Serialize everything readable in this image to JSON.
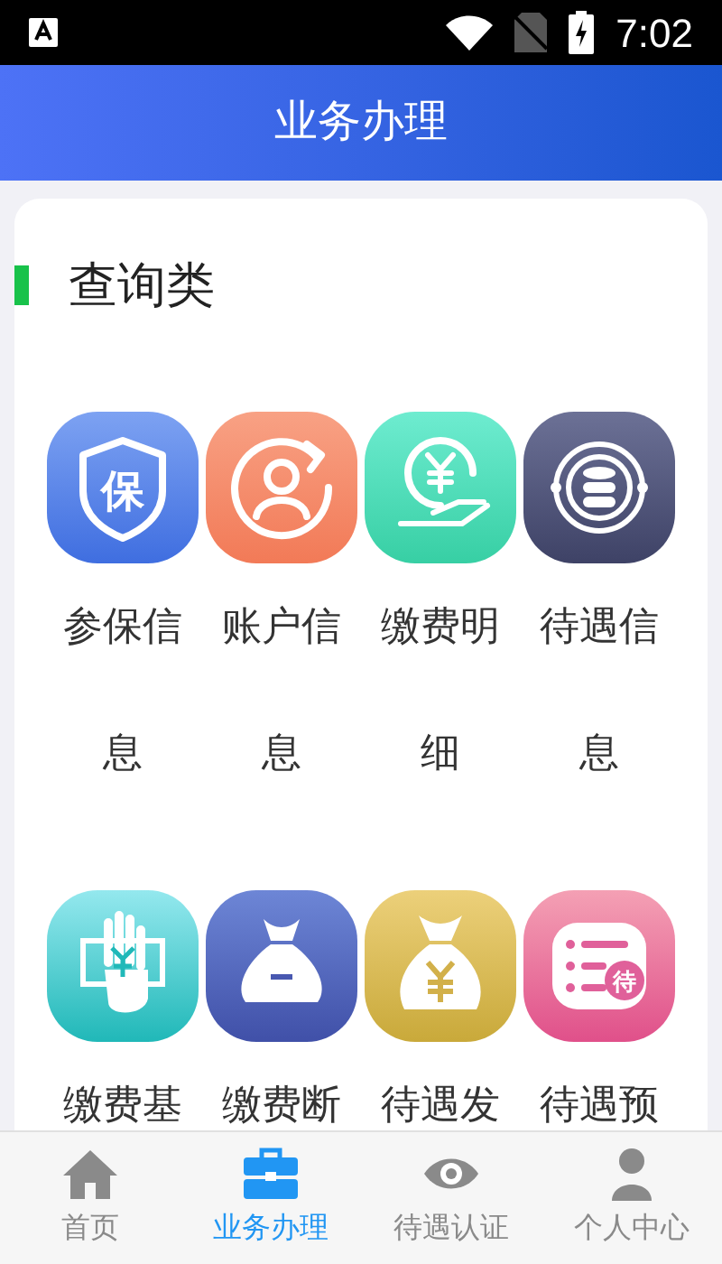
{
  "status_bar": {
    "time": "7:02"
  },
  "header": {
    "title": "业务办理"
  },
  "section": {
    "title": "查询类",
    "items": [
      {
        "kind": "shield",
        "label": "参保信息",
        "icon_text": "保"
      },
      {
        "kind": "account",
        "label": "账户信息"
      },
      {
        "kind": "payment",
        "label": "缴费明细"
      },
      {
        "kind": "database",
        "label": "待遇信息"
      },
      {
        "kind": "cash",
        "label": "缴费基"
      },
      {
        "kind": "bag-minus",
        "label": "缴费断"
      },
      {
        "kind": "bag-yen",
        "label": "待遇发"
      },
      {
        "kind": "list",
        "label": "待遇预",
        "icon_text": "待"
      }
    ]
  },
  "bottom_nav": [
    {
      "kind": "home",
      "label": "首页",
      "selected": false
    },
    {
      "kind": "briefcase",
      "label": "业务办理",
      "selected": true
    },
    {
      "kind": "eye",
      "label": "待遇认证",
      "selected": false
    },
    {
      "kind": "person",
      "label": "个人中心",
      "selected": false
    }
  ]
}
